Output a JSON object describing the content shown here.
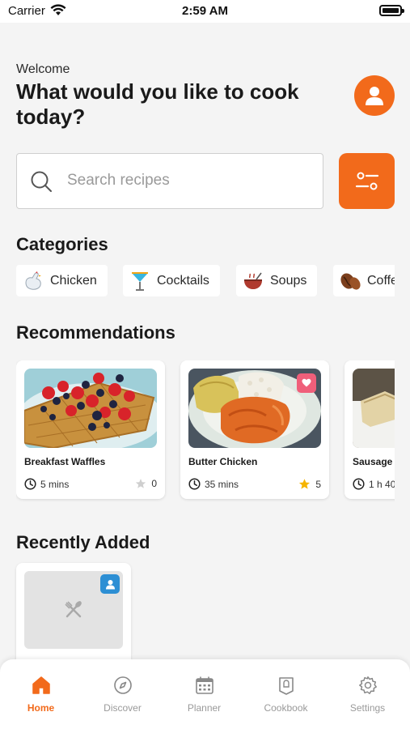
{
  "status_bar": {
    "carrier": "Carrier",
    "time": "2:59 AM"
  },
  "header": {
    "welcome": "Welcome",
    "headline": "What would you like to cook today?"
  },
  "search": {
    "placeholder": "Search recipes"
  },
  "colors": {
    "accent": "#f26a1b",
    "favorite": "#ef5f7a",
    "owner_badge": "#2d8fd4",
    "rating_star": "#f5b400"
  },
  "categories": {
    "title": "Categories",
    "items": [
      {
        "label": "Chicken",
        "icon": "chicken-icon"
      },
      {
        "label": "Cocktails",
        "icon": "cocktail-icon"
      },
      {
        "label": "Soups",
        "icon": "soup-bowl-icon"
      },
      {
        "label": "Coffee",
        "icon": "coffee-beans-icon"
      }
    ]
  },
  "recommendations": {
    "title": "Recommendations",
    "items": [
      {
        "name": "Breakfast Waffles",
        "time": "5 mins",
        "rating": "0",
        "favorite": false
      },
      {
        "name": "Butter Chicken",
        "time": "35 mins",
        "rating": "5",
        "favorite": true
      },
      {
        "name": "Sausage",
        "time": "1 h 40",
        "favorite": false
      }
    ]
  },
  "recently_added": {
    "title": "Recently Added"
  },
  "tabs": [
    {
      "label": "Home",
      "icon": "home-icon",
      "active": true
    },
    {
      "label": "Discover",
      "icon": "compass-icon",
      "active": false
    },
    {
      "label": "Planner",
      "icon": "calendar-icon",
      "active": false
    },
    {
      "label": "Cookbook",
      "icon": "cookbook-icon",
      "active": false
    },
    {
      "label": "Settings",
      "icon": "gear-icon",
      "active": false
    }
  ]
}
